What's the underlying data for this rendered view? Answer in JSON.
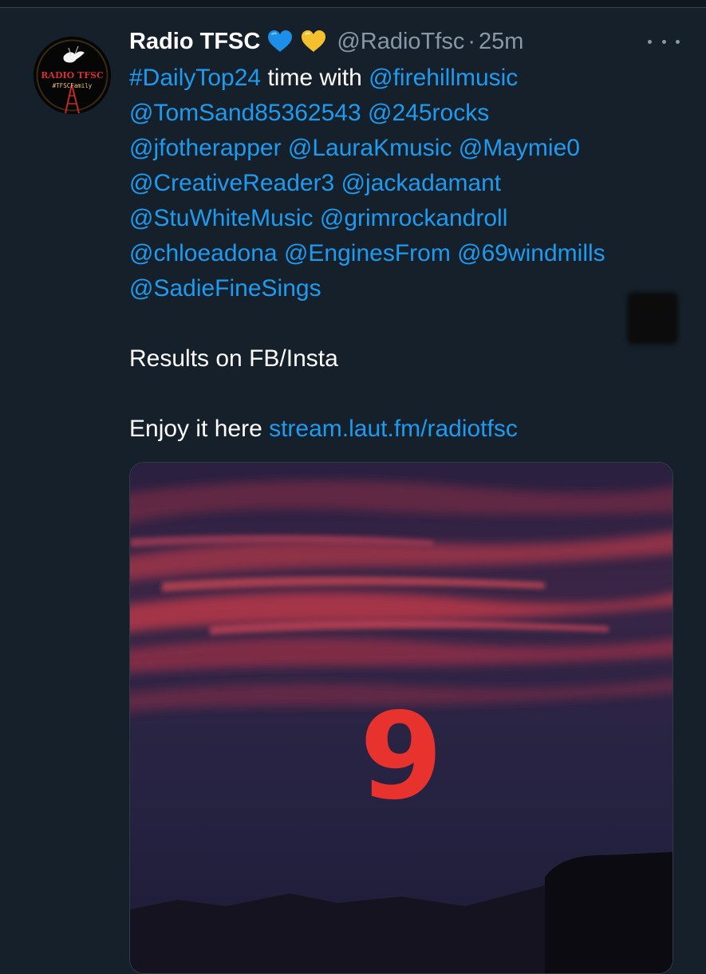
{
  "tweet": {
    "display_name": "Radio TFSC",
    "emojis": [
      "blue-heart-icon",
      "yellow-heart-icon"
    ],
    "handle": "@RadioTfsc",
    "separator": "·",
    "time": "25m",
    "more_icon": "more-dots-icon",
    "avatar": {
      "logo_text": "RADIO TFSC",
      "tag_text": "#TFSCFamily"
    },
    "body": {
      "line1": {
        "hashtag": "#DailyTop24",
        "text": " time with ",
        "mention": "@firehillmusic"
      },
      "line2": {
        "m1": "@TomSand85362543",
        "m2": "@245rocks"
      },
      "line3": {
        "m1": "@jfotherapper",
        "m2": "@LauraKmusic",
        "m3": "@Maymie0"
      },
      "line4": {
        "m1": "@CreativeReader3",
        "m2": "@jackadamant"
      },
      "line5": {
        "m1": "@StuWhiteMusic",
        "m2": "@grimrockandroll"
      },
      "line6": {
        "m1": "@chloeadona",
        "m2": "@EnginesFrom",
        "m3": "@69windmills"
      },
      "line7": {
        "m1": "@SadieFineSings"
      },
      "results": "Results on FB/Insta",
      "enjoy_text": "Enjoy it here ",
      "enjoy_link": "stream.laut.fm/radiotfsc"
    },
    "media": {
      "number_text": "9",
      "colors": {
        "sky_dark": "#1e1c3a",
        "cloud_red": "#b8394a",
        "digit": "#e8322e"
      }
    }
  },
  "colors": {
    "background": "#15202b",
    "link": "#1d9bf0",
    "secondary_text": "#8899a6"
  }
}
